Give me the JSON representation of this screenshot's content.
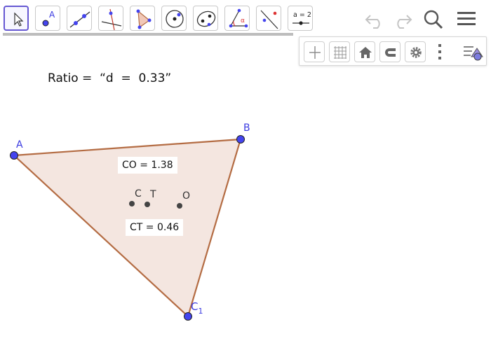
{
  "toolbar": {
    "tools": [
      {
        "name": "move-tool"
      },
      {
        "name": "point-tool",
        "label": "A"
      },
      {
        "name": "line-tool"
      },
      {
        "name": "perpendicular-line-tool"
      },
      {
        "name": "polygon-tool"
      },
      {
        "name": "circle-tool"
      },
      {
        "name": "conic-tool"
      },
      {
        "name": "angle-tool",
        "label": "α"
      },
      {
        "name": "reflect-tool"
      },
      {
        "name": "slider-tool",
        "label": "a = 2"
      }
    ],
    "undo_icon": "undo-icon",
    "redo_icon": "redo-icon",
    "search_icon": "search-icon",
    "menu_icon": "menu-icon"
  },
  "stylebar": {
    "buttons": [
      "axes-icon",
      "grid-icon",
      "home-icon",
      "magnet-icon",
      "gear-icon",
      "more-icon",
      "graphics-icon"
    ]
  },
  "canvas": {
    "ratio_text": "Ratio =  “d  =  0.33”",
    "points": {
      "A": "A",
      "B": "B",
      "C1_main": "C",
      "C1_sub": "1",
      "C": "C",
      "T": "T",
      "O": "O"
    },
    "measurements": {
      "CO": "CO = 1.38",
      "CT": "CT = 0.46"
    }
  },
  "colors": {
    "triangle_fill": "#f4e6e0",
    "triangle_stroke": "#b46c43",
    "point_blue": "#4444ee",
    "point_dark": "#444444",
    "accent": "#6557d2"
  }
}
